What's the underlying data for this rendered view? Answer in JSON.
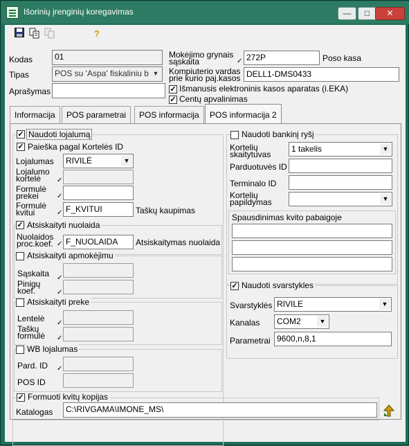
{
  "window": {
    "title": "Išorinių įrenginių koregavimas",
    "minimize": "—",
    "maximize": "□",
    "close": "✕"
  },
  "toolbar": {
    "save_icon": "save-icon",
    "print_icon": "print-icon",
    "copy_icon": "copy-icon",
    "help_icon": "help-icon"
  },
  "form": {
    "kodas_label": "Kodas",
    "kodas_value": "01",
    "tipas_label": "Tipas",
    "tipas_value": "POS su 'Aspa' fiskaliniu b",
    "aprasymas_label": "Aprašymas",
    "aprasymas_value": "",
    "mokejimo_label": "Mokėjimo grynais sąskaita",
    "mokejimo_value": "272P",
    "mokejimo_desc": "Poso kasa",
    "kompiuterio_label": "Kompiuterio vardas prie kurio paj.kasos",
    "kompiuterio_value": "DELL1-DMS0433",
    "ismanusis_label": "Išmanusis elektroninis kasos aparatas (i.EKA)",
    "ismanusis_checked": true,
    "centu_label": "Centų apvalinimas",
    "centu_checked": true
  },
  "tabs": [
    "Informacija",
    "POS parametrai",
    "POS informacija",
    "POS informacija 2"
  ],
  "active_tab": "POS informacija 2",
  "loyalty": {
    "naudoti_label": "Naudoti lojalumą",
    "naudoti_checked": true,
    "paieska_label": "Paieška pagal Kortelės ID",
    "paieska_checked": true,
    "lojalumas_label": "Lojalumas",
    "lojalumas_value": "RIVILĖ",
    "kortele_label": "Lojalumo kortelė",
    "prekei_label": "Formulė prekei",
    "kvitui_label": "Formulė kvitui",
    "kvitui_value": "F_KVITUI",
    "kvitui_desc": "Taškų kaupimas"
  },
  "discount": {
    "label": "Atsiskaityti nuolaida",
    "checked": true,
    "koef_label": "Nuolaidos proc.koef.",
    "koef_value": "F_NUOLAIDA",
    "koef_desc": "Atsiskaitymas nuolaida"
  },
  "payment": {
    "label": "Atsiskaityti apmokėjimu",
    "checked": false,
    "saskaita_label": "Sąskaita",
    "pinigu_label": "Pinigų koef."
  },
  "goods": {
    "label": "Atsiskaityti preke",
    "checked": false,
    "lentele_label": "Lentelė",
    "tasku_label": "Taškų formulė"
  },
  "wb": {
    "label": "WB lojalumas",
    "checked": false,
    "pard_label": "Pard. ID",
    "pos_label": "POS ID"
  },
  "bank": {
    "label": "Naudoti bankinį ryšį",
    "checked": false,
    "skaitytuvas_label": "Kortelių skaitytuvas",
    "skaitytuvas_value": "1 takelis",
    "parduotuves_label": "Parduotuvės ID",
    "terminalo_label": "Terminalo ID",
    "papildymas_label": "Kortelių papildymas",
    "spausdinimas_label": "Spausdinimas kvito pabaigoje"
  },
  "scales": {
    "label": "Naudoti svarstykles",
    "checked": true,
    "svarstykles_label": "Svarstyklės",
    "svarstykles_value": "RIVILE",
    "kanalas_label": "Kanalas",
    "kanalas_value": "COM2",
    "parametrai_label": "Parametrai",
    "parametrai_value": "9600,n,8,1"
  },
  "copies": {
    "label": "Formuoti kvitų kopijas",
    "checked": true,
    "katalogas_label": "Katalogas",
    "katalogas_value": "C:\\RIVGAMA\\IMONE_MS\\"
  },
  "colors": {
    "title_bar": "#2e7b63",
    "client_bg": "#f0f0f0"
  }
}
